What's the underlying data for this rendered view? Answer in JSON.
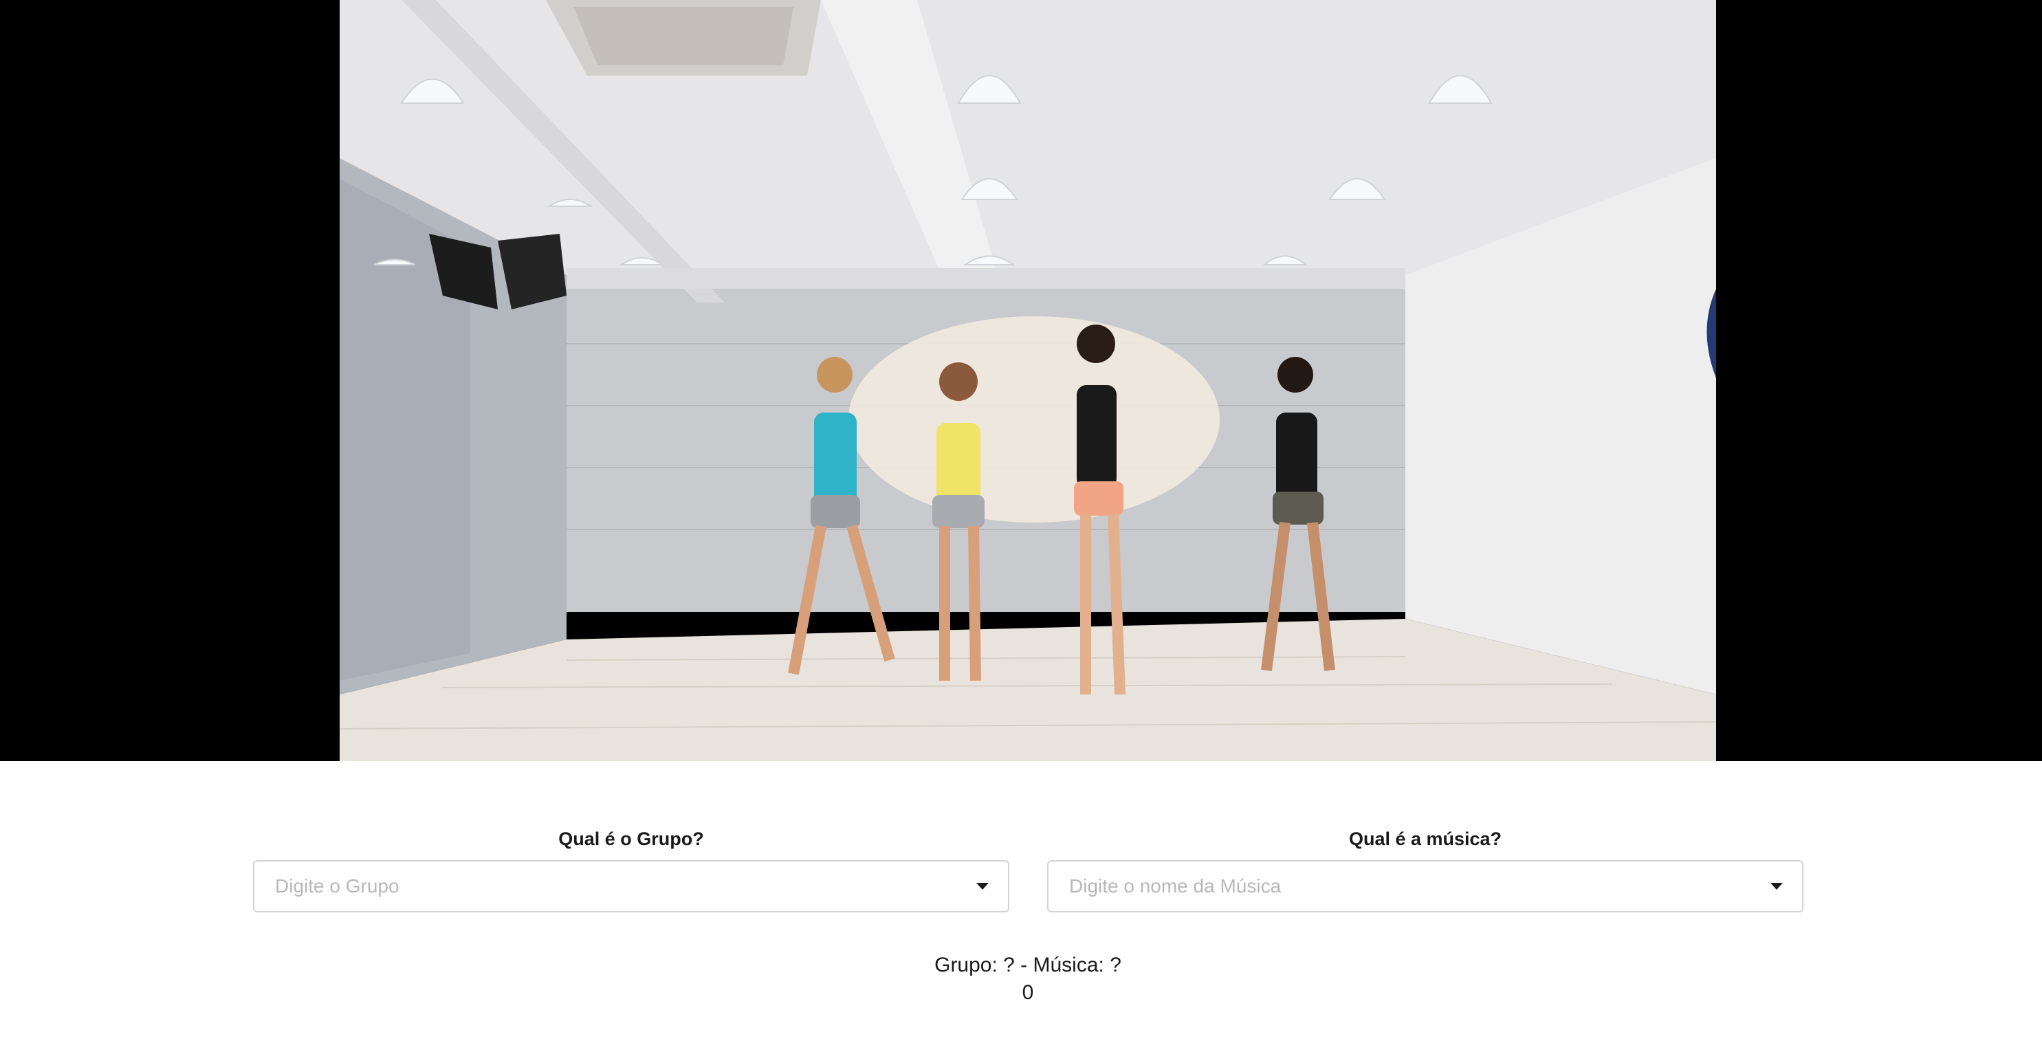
{
  "video": {
    "background": "#000000",
    "scene": "dance-practice-room"
  },
  "quiz": {
    "group": {
      "label": "Qual é o Grupo?",
      "placeholder": "Digite o Grupo",
      "value": "",
      "icon": "dropdown-caret-icon"
    },
    "song": {
      "label": "Qual é a música?",
      "placeholder": "Digite o nome da Música",
      "value": "",
      "icon": "dropdown-caret-icon"
    },
    "status": "Grupo: ? - Música: ?",
    "score": "0"
  }
}
